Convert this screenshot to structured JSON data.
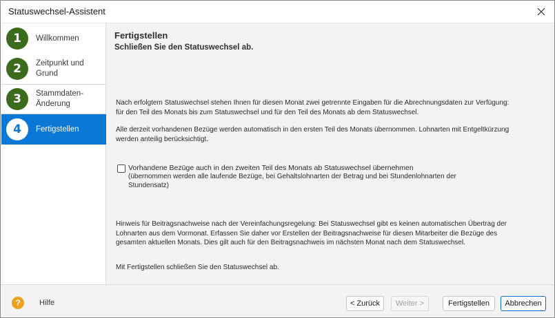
{
  "window": {
    "title": "Statuswechsel-Assistent"
  },
  "sidebar": {
    "steps": [
      {
        "number": "1",
        "label": "Willkommen"
      },
      {
        "number": "2",
        "label": "Zeitpunkt und Grund"
      },
      {
        "number": "3",
        "label": "Stammdaten-Änderung"
      },
      {
        "number": "4",
        "label": "Fertigstellen"
      }
    ],
    "active_step": 4
  },
  "content": {
    "heading": "Fertigstellen",
    "subheading": "Schließen Sie den Statuswechsel ab.",
    "paragraph1": "Nach erfolgtem Statuswechsel stehen Ihnen für diesen Monat zwei getrennte Eingaben für die Abrechnungsdaten zur Verfügung: für den Teil des Monats bis zum Statuswechsel und für den Teil des Monats ab dem Statuswechsel.",
    "paragraph2": "Alle derzeit vorhandenen Bezüge werden automatisch in den ersten Teil des Monats übernommen. Lohnarten mit Entgeltkürzung werden anteilig berücksichtigt.",
    "checkbox_label": "Vorhandene Bezüge auch in den zweiten Teil des Monats ab Statuswechsel übernehmen",
    "checkbox_note": "(übernommen werden alle laufende Bezüge, bei Gehaltslohnarten der Betrag und bei Stundenlohnarten der Stundensatz)",
    "checkbox_checked": false,
    "paragraph3": "Hinweis für Beitragsnachweise nach der Vereinfachungsregelung: Bei Statuswechsel gibt es keinen automatischen Übertrag der Lohnarten aus dem Vormonat. Erfassen Sie daher vor Erstellen der Beitragsnachweise für diesen Mitarbeiter die Bezüge des gesamten aktuellen Monats. Dies gilt auch für den Beitragsnachweis im nächsten Monat nach dem Statuswechsel.",
    "paragraph4": "Mit Fertigstellen schließen Sie den Statuswechsel ab."
  },
  "footer": {
    "help_icon_glyph": "?",
    "help_label": "Hilfe",
    "back_label": "< Zurück",
    "next_label": "Weiter >",
    "finish_label": "Fertigstellen",
    "cancel_label": "Abbrechen"
  },
  "colors": {
    "accent": "#0a78d4",
    "step_badge": "#3c6b1d",
    "help_icon": "#f0a020"
  }
}
